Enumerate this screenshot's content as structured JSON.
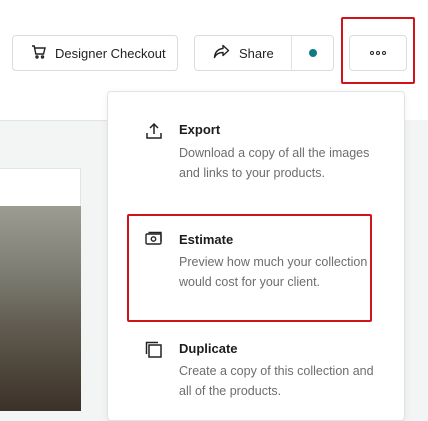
{
  "toolbar": {
    "designer_checkout_label": "Designer Checkout",
    "share_label": "Share",
    "status_dot_color": "#0e7c86",
    "more_icon": "more-horizontal-icon"
  },
  "menu": {
    "items": [
      {
        "title": "Export",
        "description": "Download a copy of all the images and links to your products.",
        "icon": "upload-icon"
      },
      {
        "title": "Estimate",
        "description": "Preview how much your collection would cost for your client.",
        "icon": "estimate-icon"
      },
      {
        "title": "Duplicate",
        "description": "Create a copy of this collection and all of the products.",
        "icon": "duplicate-icon"
      }
    ]
  },
  "annotations": {
    "highlight_color": "#d0141c"
  }
}
